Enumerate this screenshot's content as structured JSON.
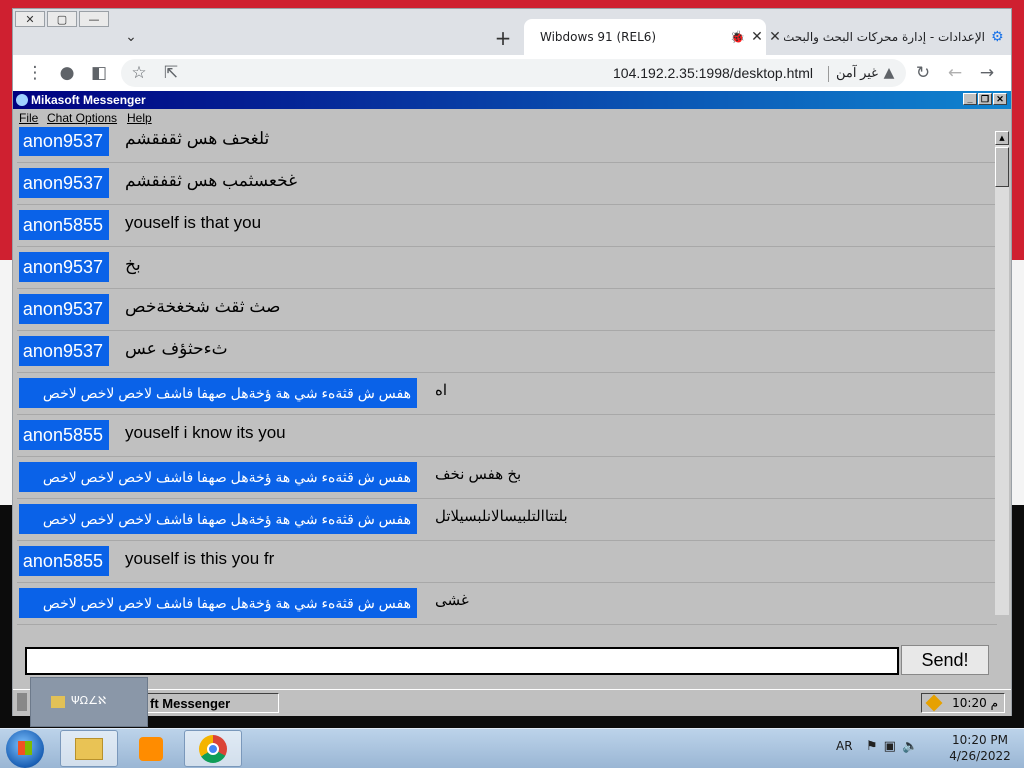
{
  "browser": {
    "window_buttons": [
      "✕",
      "▢",
      "—"
    ],
    "tabs": [
      {
        "title": "Wibdows 91 (REL6)",
        "close": "✕",
        "active": true
      },
      {
        "title": "الإعدادات - إدارة محركات البحث والبحث في",
        "close": "✕",
        "active": false
      }
    ],
    "new_tab": "+",
    "tab_list": "⌄",
    "url": "104.192.2.35:1998/desktop.html",
    "security_label": "غير آمن"
  },
  "app": {
    "title": "Mikasoft Messenger",
    "menu": [
      "File",
      "Chat Options",
      "Help"
    ],
    "messages": [
      {
        "author": "anon9537",
        "text": "ثلغحف هس ثقفقشم"
      },
      {
        "author": "anon9537",
        "text": "غخعسثمب هس ثقفقشم"
      },
      {
        "author": "anon5855",
        "text": "youself is that you"
      },
      {
        "author": "anon9537",
        "text": "بخ"
      },
      {
        "author": "anon9537",
        "text": "صث ثقث شخغخةخص"
      },
      {
        "author": "anon9537",
        "text": "ثءحثؤف عس"
      },
      {
        "author": "هفس ش قثةهء شي هة ؤخةهل صهفا فاشف لاخص لاخص لاخص",
        "text": "اه"
      },
      {
        "author": "anon5855",
        "text": "youself i know its you"
      },
      {
        "author": "هفس ش قثةهء شي هة ؤخةهل صهفا فاشف لاخص لاخص لاخص",
        "text": "بخ هفس نخف"
      },
      {
        "author": "هفس ش قثةهء شي هة ؤخةهل صهفا فاشف لاخص لاخص لاخص",
        "text": "بلتتاالتلبيسالانلبسيلاتل"
      },
      {
        "author": "anon5855",
        "text": "youself is this you fr"
      },
      {
        "author": "هفس ش قثةهء شي هة ؤخةهل صهفا فاشف لاخص لاخص لاخص",
        "text": "غشى"
      }
    ],
    "input_value": "",
    "send_label": "Send!",
    "taskbar_item": "ft Messenger",
    "tray_time": "10:20 م"
  },
  "thumbnail": {
    "label": "ΨΩ∠ℵ"
  },
  "os_taskbar": {
    "lang": "AR",
    "time": "10:20 PM",
    "date": "4/26/2022"
  },
  "colors": {
    "author_bg": "#0a62e8",
    "window_title": "#000080"
  }
}
